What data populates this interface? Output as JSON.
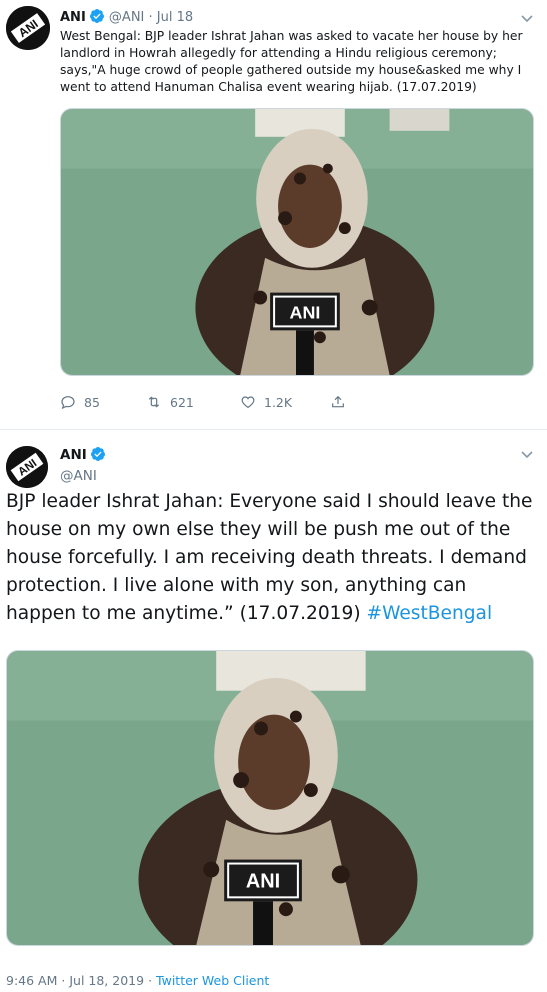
{
  "tweet1": {
    "author_name": "ANI",
    "handle": "@ANI",
    "separator": "·",
    "date": "Jul 18",
    "text": "West Bengal: BJP leader Ishrat Jahan was asked to vacate her house by her landlord in Howrah allegedly for attending a Hindu religious ceremony; says,\"A huge crowd of people gathered outside my house&asked me why I went to attend Hanuman Chalisa event wearing hijab. (17.07.2019)",
    "media_logo_text": "ANI",
    "reply_count": "85",
    "retweet_count": "621",
    "like_count": "1.2K",
    "avatar_text": "ANI"
  },
  "tweet2": {
    "author_name": "ANI",
    "handle": "@ANI",
    "text": "BJP leader Ishrat Jahan: Everyone said I should leave the house on my own else they will be push me out of the house forcefully. I am receiving death threats. I demand protection. I live alone with my son, anything can happen to me anytime.” (17.07.2019) ",
    "hashtag": "#WestBengal",
    "media_logo_text": "ANI",
    "time": "9:46 AM",
    "date": "Jul 18, 2019",
    "separator": "·",
    "client": "Twitter Web Client",
    "avatar_text": "ANI"
  },
  "icons": {
    "verified": "verified-badge-icon",
    "caret": "chevron-down-icon",
    "reply": "reply-icon",
    "retweet": "retweet-icon",
    "like": "heart-icon",
    "share": "share-icon"
  },
  "colors": {
    "link": "#1b95e0",
    "muted": "#657786",
    "text": "#14171a",
    "wall": "#79a48a"
  }
}
